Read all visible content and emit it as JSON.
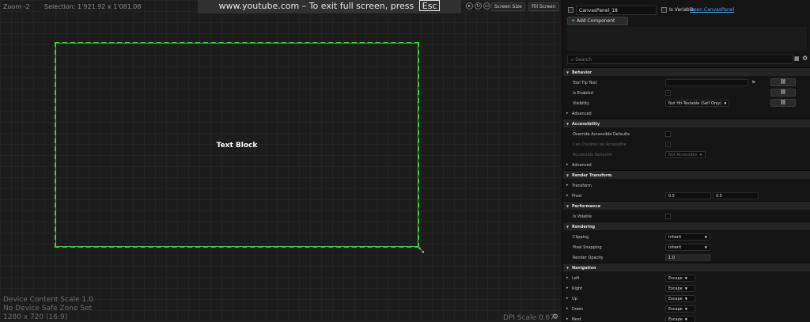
{
  "viewport": {
    "zoom": "Zoom -2",
    "selection": "Selection: 1'921.92 x 1'081.08",
    "fullscreen_msg": "www.youtube.com – To exit full screen, press",
    "esc_key": "Esc",
    "text_block": "Text Block",
    "screen_size": "Screen Size",
    "fill_screen": "Fill Screen",
    "info_lines": [
      "Device Content Scale 1.0",
      "No Device Safe Zone Set",
      "1280 x 720 (16:9)"
    ],
    "dpi_scale": "DPI Scale 0.67",
    "canvas_outline_color": "#3fd13f"
  },
  "details": {
    "widget_name": "CanvasPanel_18",
    "is_variable_label": "Is Variable",
    "open_link": "Open CanvasPanel",
    "add_component": "Add Component",
    "search_placeholder": "Search",
    "behavior": {
      "title": "Behavior",
      "tool_tip_text": "Tool Tip Text",
      "is_enabled": "Is Enabled",
      "visibility": "Visibility",
      "visibility_value": "Not Hit-Testable (Self Only)",
      "advanced": "Advanced"
    },
    "accessibility": {
      "title": "Accessibility",
      "override": "Override Accessible Defaults",
      "children": "Can Children be Accessible",
      "behavior": "Accessible Behavior",
      "behavior_value": "Not Accessible",
      "advanced": "Advanced"
    },
    "render_transform": {
      "title": "Render Transform",
      "transform": "Transform",
      "pivot": "Pivot",
      "pivot_x": "0.5",
      "pivot_y": "0.5"
    },
    "performance": {
      "title": "Performance",
      "is_volatile": "Is Volatile"
    },
    "rendering": {
      "title": "Rendering",
      "clipping": "Clipping",
      "clipping_value": "Inherit",
      "pixel_snapping": "Pixel Snapping",
      "pixel_snapping_value": "Inherit",
      "render_opacity": "Render Opacity",
      "render_opacity_value": "1.0"
    },
    "navigation": {
      "title": "Navigation",
      "left": "Left",
      "right": "Right",
      "up": "Up",
      "down": "Down",
      "next": "Next",
      "value": "Escape"
    }
  }
}
